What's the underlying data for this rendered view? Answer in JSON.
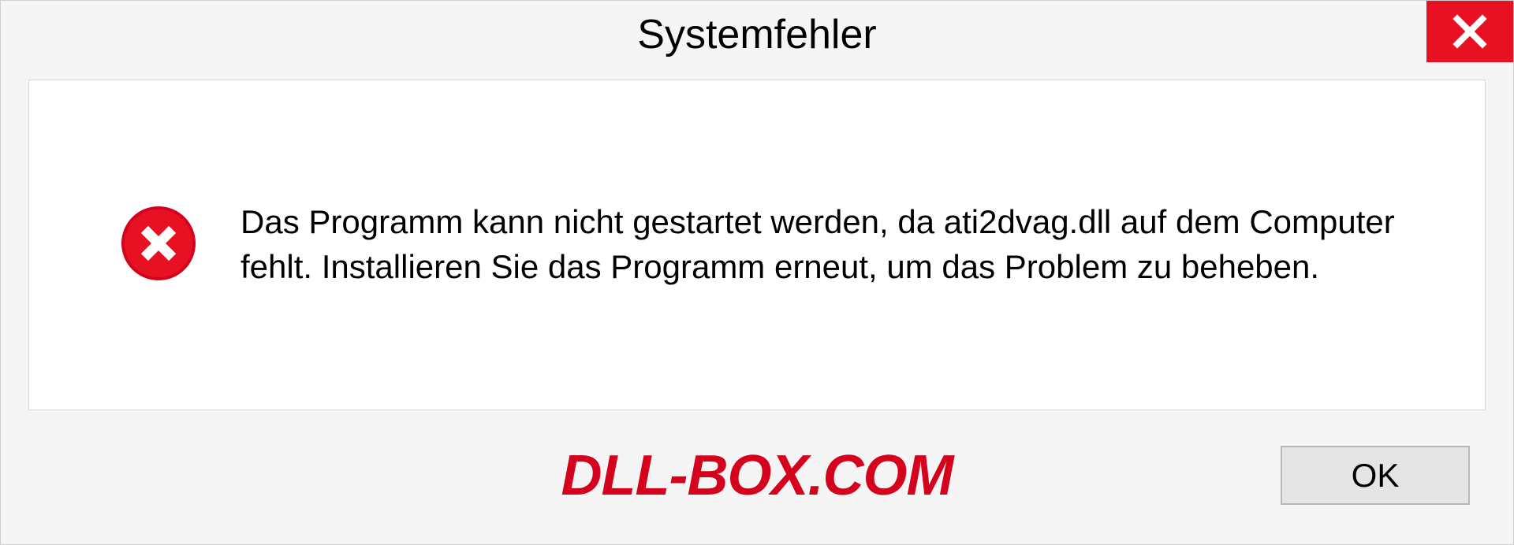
{
  "dialog": {
    "title": "Systemfehler",
    "message": "Das Programm kann nicht gestartet werden, da ati2dvag.dll auf dem Computer fehlt. Installieren Sie das Programm erneut, um das Problem zu beheben.",
    "ok_label": "OK"
  },
  "watermark": "DLL-BOX.COM"
}
